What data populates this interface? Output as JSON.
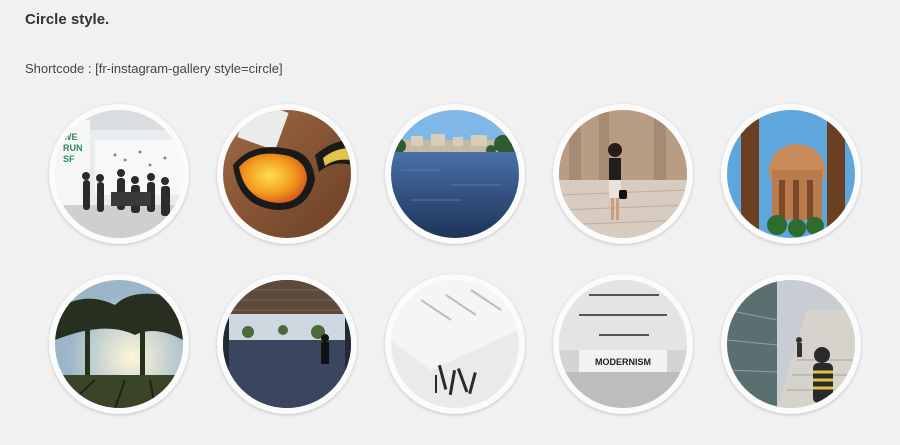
{
  "section": {
    "title": "Circle style.",
    "shortcode_text": "Shortcode : [fr-instagram-gallery style=circle]"
  },
  "gallery": {
    "items": [
      {
        "name": "photo-nike-run-event"
      },
      {
        "name": "photo-sunglasses"
      },
      {
        "name": "photo-lake-city"
      },
      {
        "name": "photo-woman-courtyard"
      },
      {
        "name": "photo-columns-palace"
      },
      {
        "name": "photo-trees-sunset"
      },
      {
        "name": "photo-overpass-walkway"
      },
      {
        "name": "photo-gallery-ceiling"
      },
      {
        "name": "photo-modernism-exhibit"
      },
      {
        "name": "photo-stairway-corridor"
      }
    ]
  }
}
